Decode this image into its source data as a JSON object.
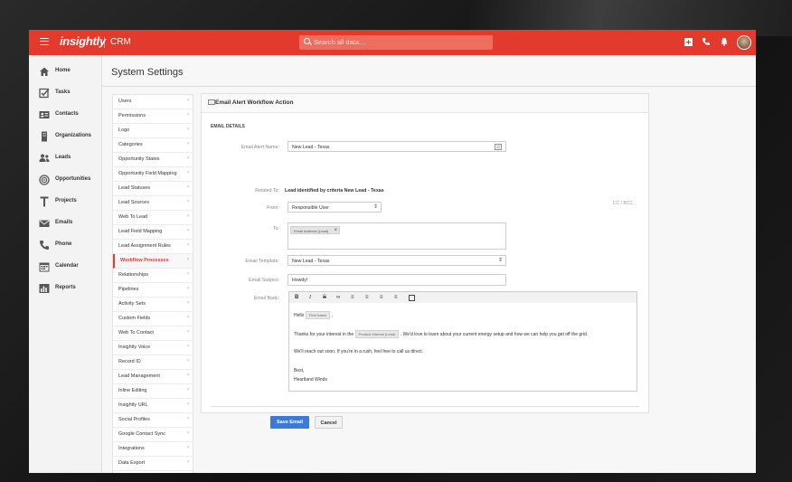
{
  "header": {
    "logo": "insightly",
    "app_name": "CRM",
    "search_placeholder": "Search all data....",
    "colors": {
      "brand": "#e23b2e",
      "primary_button": "#3b7ad9"
    }
  },
  "sidenav": {
    "items": [
      {
        "label": "Home",
        "icon": "home-icon"
      },
      {
        "label": "Tasks",
        "icon": "tasks-icon"
      },
      {
        "label": "Contacts",
        "icon": "contacts-icon"
      },
      {
        "label": "Organizations",
        "icon": "organizations-icon"
      },
      {
        "label": "Leads",
        "icon": "leads-icon"
      },
      {
        "label": "Opportunities",
        "icon": "opportunities-icon"
      },
      {
        "label": "Projects",
        "icon": "projects-icon"
      },
      {
        "label": "Emails",
        "icon": "emails-icon"
      },
      {
        "label": "Phone",
        "icon": "phone-icon"
      },
      {
        "label": "Calendar",
        "icon": "calendar-icon"
      },
      {
        "label": "Reports",
        "icon": "reports-icon"
      }
    ]
  },
  "page": {
    "title": "System Settings"
  },
  "settings_menu": {
    "items": [
      "Users",
      "Permissions",
      "Logo",
      "Categories",
      "Opportunity States",
      "Opportunity Field Mapping",
      "Lead Statuses",
      "Lead Sources",
      "Web To Lead",
      "Lead Field Mapping",
      "Lead Assignment Rules",
      "Workflow Processes",
      "Relationships",
      "Pipelines",
      "Activity Sets",
      "Custom Fields",
      "Web To Contact",
      "Insightly Voice",
      "Record ID",
      "Lead Management",
      "Inline Editing",
      "Insightly URL",
      "Social Profiles",
      "Google Contact Sync",
      "Integrations",
      "Data Export"
    ],
    "active": "Workflow Processes"
  },
  "form": {
    "title": "Email Alert Workflow Action",
    "section": "EMAIL DETAILS",
    "labels": {
      "name": "Email Alert Name:",
      "related": "Related To:",
      "from": "From:",
      "to": "To:",
      "template": "Email Template:",
      "subject": "Email Subject:",
      "body": "Email Body:"
    },
    "values": {
      "name": "New Lead - Texas",
      "related": "Lead identified by criteria New Lead - Texas",
      "from": "Responsible User",
      "to_chip": "Email Address (Lead)",
      "template": "New Lead - Texas",
      "subject": "Howdy!"
    },
    "cc_bcc": "CC / BCC",
    "body": {
      "greeting": "Hello",
      "first_name_tag": "First Name",
      "comma": ",",
      "line1_start": "Thanks for your interest in the",
      "product_tag": "Product Interest (Lead)",
      "line1_end": ". We'd love to learn about your current energy setup and how we can help you get off the grid.",
      "line2": "We'll reach out soon. If you're in a rush, feel free to call us direct.",
      "signoff": "Best,",
      "signature": "Heartland Winds"
    },
    "buttons": {
      "save": "Save Email",
      "cancel": "Cancel"
    }
  }
}
